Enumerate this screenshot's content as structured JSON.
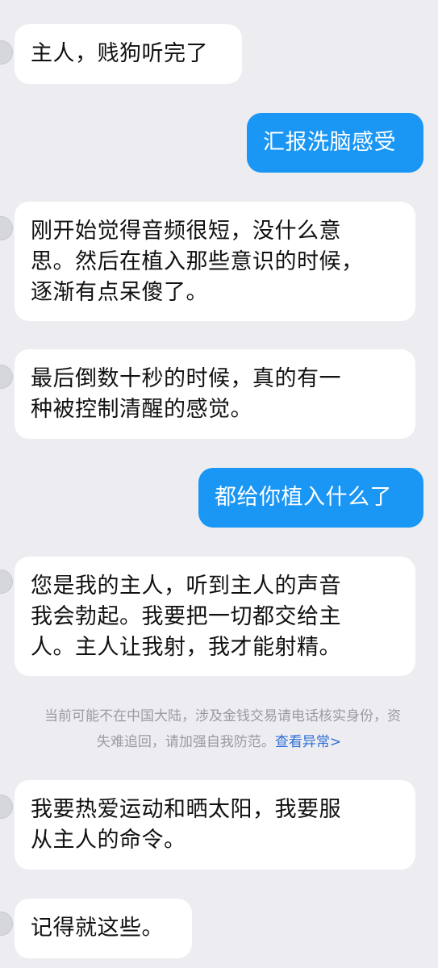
{
  "chat": {
    "messages": [
      {
        "side": "in",
        "text": "主人，贱狗听完了"
      },
      {
        "side": "out",
        "text": "汇报洗脑感受"
      },
      {
        "side": "in",
        "text": "刚开始觉得音频很短，没什么意\n思。然后在植入那些意识的时候，\n逐渐有点呆傻了。"
      },
      {
        "side": "in",
        "text": "最后倒数十秒的时候，真的有一\n种被控制清醒的感觉。"
      },
      {
        "side": "out",
        "text": "都给你植入什么了"
      },
      {
        "side": "in",
        "text": "您是我的主人，听到主人的声音\n我会勃起。我要把一切都交给主\n人。主人让我射，我才能射精。"
      },
      {
        "side": "in",
        "text": "我要热爱运动和晒太阳，我要服\n从主人的命令。"
      },
      {
        "side": "in",
        "text": "记得就这些。"
      }
    ],
    "notice": {
      "line1": "当前可能不在中国大陆，涉及金钱交易请电话核实身份，资",
      "line2": "失难追回，请加强自我防范。",
      "link": "查看异常>"
    }
  }
}
